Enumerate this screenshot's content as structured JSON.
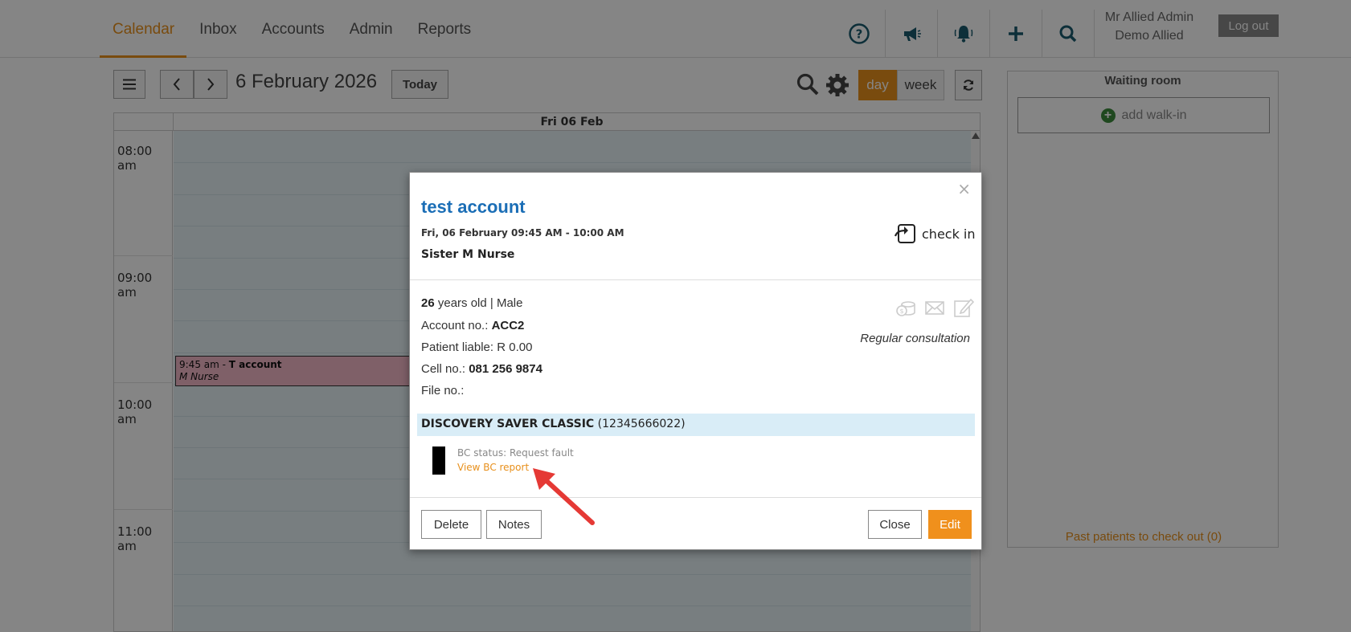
{
  "nav": {
    "tabs": [
      {
        "label": "Calendar",
        "active": true
      },
      {
        "label": "Inbox",
        "active": false
      },
      {
        "label": "Accounts",
        "active": false
      },
      {
        "label": "Admin",
        "active": false
      },
      {
        "label": "Reports",
        "active": false
      }
    ],
    "icons": [
      "help-icon",
      "megaphone-icon",
      "bell-icon",
      "plus-icon",
      "search-icon"
    ],
    "user_name": "Mr Allied Admin",
    "practice_name": "Demo Allied",
    "logout_label": "Log out"
  },
  "toolbar": {
    "date_title": "6 February 2026",
    "today_label": "Today",
    "day_label": "day",
    "week_label": "week"
  },
  "calendar": {
    "column_header": "Fri 06 Feb",
    "times": [
      "08:00 am",
      "09:00 am",
      "10:00 am",
      "11:00 am"
    ],
    "appointment": {
      "time": "9:45 am",
      "separator": " - ",
      "patient": "T account",
      "provider": "M Nurse"
    }
  },
  "waiting_room": {
    "title": "Waiting room",
    "add_walkin_label": "add walk-in",
    "past_patients_label": "Past patients to check out (0)"
  },
  "modal": {
    "close_glyph": "×",
    "title": "test account",
    "datetime": "Fri, 06 February 09:45 AM - 10:00 AM",
    "provider": "Sister M Nurse",
    "checkin_label": "check in",
    "age": "26",
    "age_suffix": " years old",
    "sex": "Male",
    "account_label": "Account no.: ",
    "account_no": "ACC2",
    "liable_label": "Patient liable: ",
    "liable_value": "R 0.00",
    "cell_label": "Cell no.: ",
    "cell_no": "081 256 9874",
    "file_label": "File no.:",
    "reason": "Regular consultation",
    "scheme_name": "DISCOVERY SAVER CLASSIC",
    "scheme_number": " (12345666022)",
    "bc_status": "BC status: Request fault",
    "bc_link": "View BC report",
    "buttons": {
      "delete": "Delete",
      "notes": "Notes",
      "close": "Close",
      "edit": "Edit"
    }
  },
  "colors": {
    "accent": "#e8901c",
    "title_blue": "#1b6eb6",
    "appointment_pink": "#f4b8c8",
    "arrow_red": "#e53935"
  }
}
